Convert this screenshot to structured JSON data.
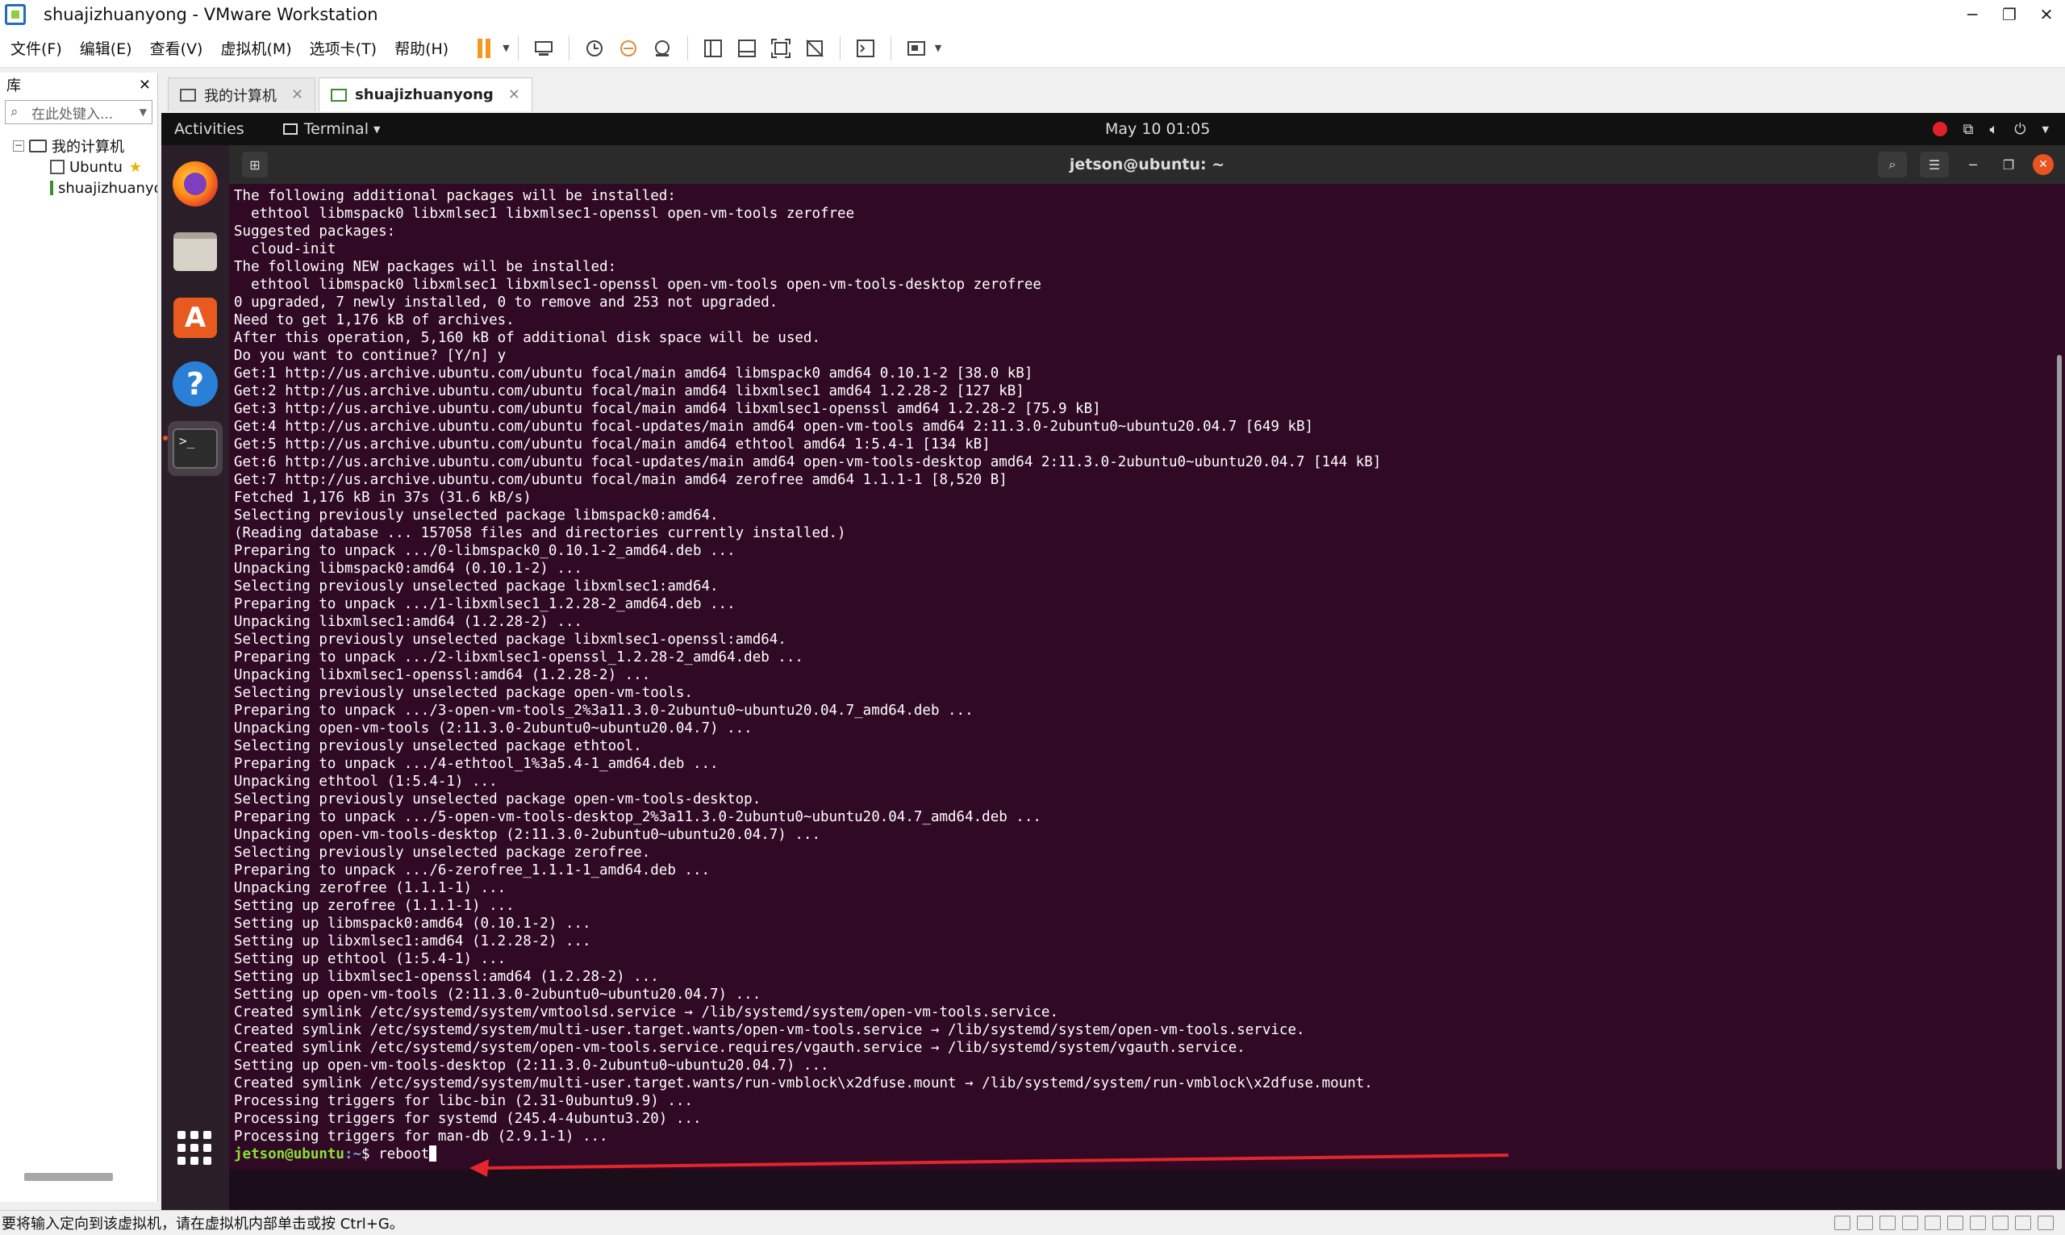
{
  "window": {
    "title": "shuajizhuanyong - VMware Workstation"
  },
  "menu": [
    "文件(F)",
    "编辑(E)",
    "查看(V)",
    "虚拟机(M)",
    "选项卡(T)",
    "帮助(H)"
  ],
  "library": {
    "title": "库",
    "search_placeholder": "在此处键入...",
    "root": "我的计算机",
    "items": [
      "Ubuntu",
      "shuajizhuanyong"
    ]
  },
  "tabs": [
    {
      "label": "我的计算机"
    },
    {
      "label": "shuajizhuanyong"
    }
  ],
  "gnome": {
    "activities": "Activities",
    "app_menu": "Terminal",
    "clock": "May 10  01:05"
  },
  "terminal": {
    "title": "jetson@ubuntu: ~",
    "lines": [
      "The following additional packages will be installed:",
      "  ethtool libmspack0 libxmlsec1 libxmlsec1-openssl open-vm-tools zerofree",
      "Suggested packages:",
      "  cloud-init",
      "The following NEW packages will be installed:",
      "  ethtool libmspack0 libxmlsec1 libxmlsec1-openssl open-vm-tools open-vm-tools-desktop zerofree",
      "0 upgraded, 7 newly installed, 0 to remove and 253 not upgraded.",
      "Need to get 1,176 kB of archives.",
      "After this operation, 5,160 kB of additional disk space will be used.",
      "Do you want to continue? [Y/n] y",
      "Get:1 http://us.archive.ubuntu.com/ubuntu focal/main amd64 libmspack0 amd64 0.10.1-2 [38.0 kB]",
      "Get:2 http://us.archive.ubuntu.com/ubuntu focal/main amd64 libxmlsec1 amd64 1.2.28-2 [127 kB]",
      "Get:3 http://us.archive.ubuntu.com/ubuntu focal/main amd64 libxmlsec1-openssl amd64 1.2.28-2 [75.9 kB]",
      "Get:4 http://us.archive.ubuntu.com/ubuntu focal-updates/main amd64 open-vm-tools amd64 2:11.3.0-2ubuntu0~ubuntu20.04.7 [649 kB]",
      "Get:5 http://us.archive.ubuntu.com/ubuntu focal/main amd64 ethtool amd64 1:5.4-1 [134 kB]",
      "Get:6 http://us.archive.ubuntu.com/ubuntu focal-updates/main amd64 open-vm-tools-desktop amd64 2:11.3.0-2ubuntu0~ubuntu20.04.7 [144 kB]",
      "Get:7 http://us.archive.ubuntu.com/ubuntu focal/main amd64 zerofree amd64 1.1.1-1 [8,520 B]",
      "Fetched 1,176 kB in 37s (31.6 kB/s)",
      "Selecting previously unselected package libmspack0:amd64.",
      "(Reading database ... 157058 files and directories currently installed.)",
      "Preparing to unpack .../0-libmspack0_0.10.1-2_amd64.deb ...",
      "Unpacking libmspack0:amd64 (0.10.1-2) ...",
      "Selecting previously unselected package libxmlsec1:amd64.",
      "Preparing to unpack .../1-libxmlsec1_1.2.28-2_amd64.deb ...",
      "Unpacking libxmlsec1:amd64 (1.2.28-2) ...",
      "Selecting previously unselected package libxmlsec1-openssl:amd64.",
      "Preparing to unpack .../2-libxmlsec1-openssl_1.2.28-2_amd64.deb ...",
      "Unpacking libxmlsec1-openssl:amd64 (1.2.28-2) ...",
      "Selecting previously unselected package open-vm-tools.",
      "Preparing to unpack .../3-open-vm-tools_2%3a11.3.0-2ubuntu0~ubuntu20.04.7_amd64.deb ...",
      "Unpacking open-vm-tools (2:11.3.0-2ubuntu0~ubuntu20.04.7) ...",
      "Selecting previously unselected package ethtool.",
      "Preparing to unpack .../4-ethtool_1%3a5.4-1_amd64.deb ...",
      "Unpacking ethtool (1:5.4-1) ...",
      "Selecting previously unselected package open-vm-tools-desktop.",
      "Preparing to unpack .../5-open-vm-tools-desktop_2%3a11.3.0-2ubuntu0~ubuntu20.04.7_amd64.deb ...",
      "Unpacking open-vm-tools-desktop (2:11.3.0-2ubuntu0~ubuntu20.04.7) ...",
      "Selecting previously unselected package zerofree.",
      "Preparing to unpack .../6-zerofree_1.1.1-1_amd64.deb ...",
      "Unpacking zerofree (1.1.1-1) ...",
      "Setting up zerofree (1.1.1-1) ...",
      "Setting up libmspack0:amd64 (0.10.1-2) ...",
      "Setting up libxmlsec1:amd64 (1.2.28-2) ...",
      "Setting up ethtool (1:5.4-1) ...",
      "Setting up libxmlsec1-openssl:amd64 (1.2.28-2) ...",
      "Setting up open-vm-tools (2:11.3.0-2ubuntu0~ubuntu20.04.7) ...",
      "Created symlink /etc/systemd/system/vmtoolsd.service → /lib/systemd/system/open-vm-tools.service.",
      "Created symlink /etc/systemd/system/multi-user.target.wants/open-vm-tools.service → /lib/systemd/system/open-vm-tools.service.",
      "Created symlink /etc/systemd/system/open-vm-tools.service.requires/vgauth.service → /lib/systemd/system/vgauth.service.",
      "Setting up open-vm-tools-desktop (2:11.3.0-2ubuntu0~ubuntu20.04.7) ...",
      "Created symlink /etc/systemd/system/multi-user.target.wants/run-vmblock\\x2dfuse.mount → /lib/systemd/system/run-vmblock\\x2dfuse.mount.",
      "Processing triggers for libc-bin (2.31-0ubuntu9.9) ...",
      "Processing triggers for systemd (245.4-4ubuntu3.20) ...",
      "Processing triggers for man-db (2.9.1-1) ..."
    ],
    "prompt_user": "jetson@ubuntu",
    "prompt_path": ":~",
    "prompt_symbol": "$ ",
    "command": "reboot"
  },
  "status_bar": {
    "text": "要将输入定向到该虚拟机，请在虚拟机内部单击或按 Ctrl+G。"
  },
  "colors": {
    "terminal_bg": "#300a24",
    "prompt_user": "#8ae234",
    "prompt_path": "#729fcf",
    "annotation_arrow": "#e3262b"
  }
}
